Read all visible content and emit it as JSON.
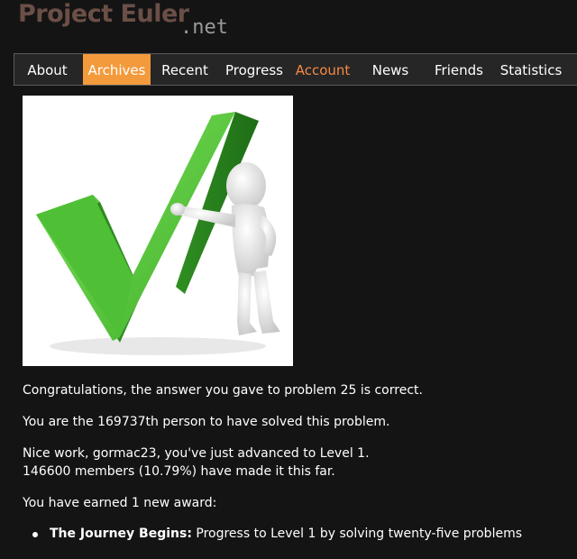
{
  "logo": {
    "main": "Project Euler",
    "suffix": ".net"
  },
  "nav": {
    "items": [
      {
        "label": "About",
        "state": "normal"
      },
      {
        "label": "Archives",
        "state": "active"
      },
      {
        "label": "Recent",
        "state": "normal"
      },
      {
        "label": "Progress",
        "state": "normal"
      },
      {
        "label": "Account",
        "state": "highlight"
      },
      {
        "label": "News",
        "state": "normal"
      },
      {
        "label": "Friends",
        "state": "normal"
      },
      {
        "label": "Statistics",
        "state": "normal"
      }
    ],
    "active_color": "#f39a3c",
    "highlight_color": "#f58a45"
  },
  "hero_icon": "green-checkmark-with-figure-image",
  "messages": {
    "congrats": "Congratulations, the answer you gave to problem 25 is correct.",
    "rank": "You are the 169737th person to have solved this problem.",
    "level_up": "Nice work, gormac23, you've just advanced to Level 1.",
    "members": "146600 members (10.79%) have made it this far.",
    "award_intro": "You have earned 1 new award:"
  },
  "awards": [
    {
      "title": "The Journey Begins:",
      "description": " Progress to Level 1 by solving twenty-five problems"
    }
  ],
  "colors": {
    "background": "#141414",
    "logo_main": "#6b4f47",
    "logo_suffix": "#9a9a9a"
  }
}
